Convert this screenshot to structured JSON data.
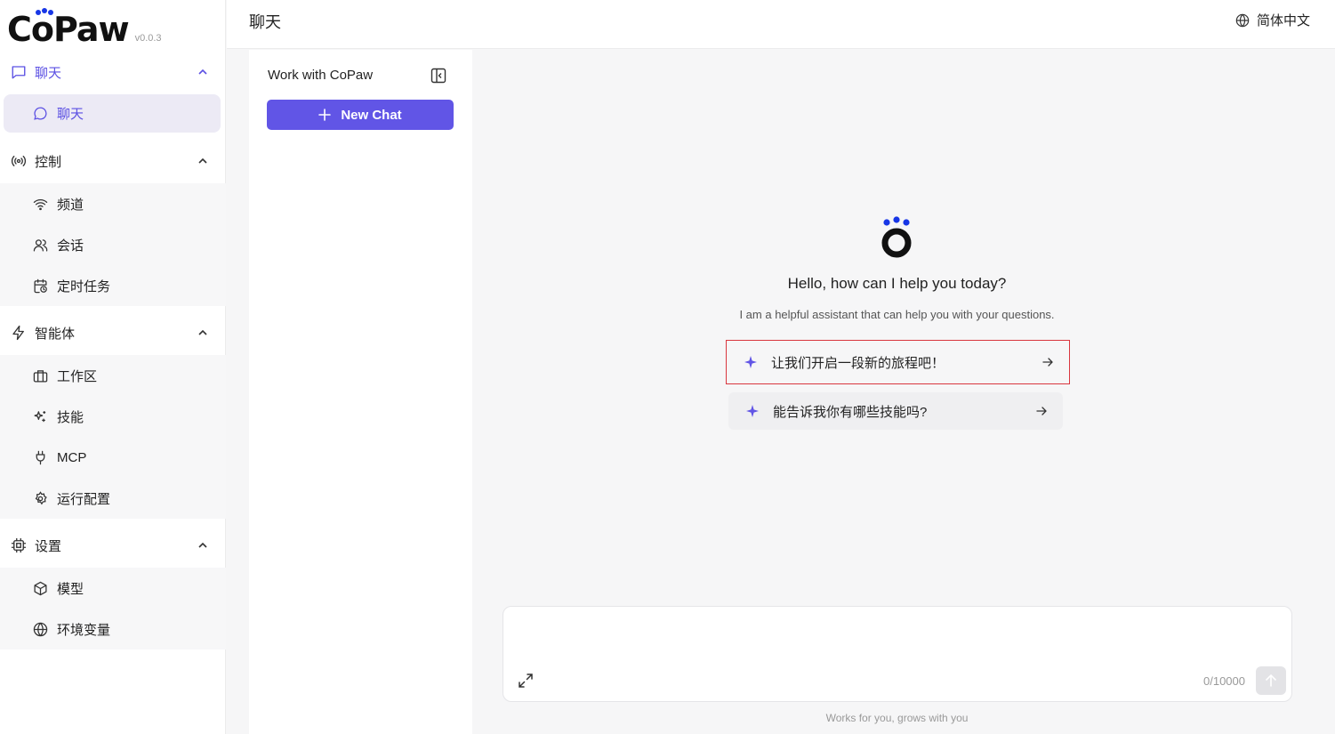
{
  "brand": {
    "name_prefix": "C",
    "name_suffix": "Paw",
    "version": "v0.0.3",
    "dot_color": "#1736e6"
  },
  "sidebar": {
    "groups": [
      {
        "label": "聊天",
        "icon": "message-square-icon",
        "items": [
          {
            "label": "聊天",
            "icon": "message-circle-icon"
          }
        ]
      },
      {
        "label": "控制",
        "icon": "radio-broadcast-icon",
        "items": [
          {
            "label": "频道",
            "icon": "wifi-icon"
          },
          {
            "label": "会话",
            "icon": "users-icon"
          },
          {
            "label": "定时任务",
            "icon": "calendar-clock-icon"
          }
        ]
      },
      {
        "label": "智能体",
        "icon": "zap-icon",
        "items": [
          {
            "label": "工作区",
            "icon": "briefcase-icon"
          },
          {
            "label": "技能",
            "icon": "sparkles-icon"
          },
          {
            "label": "MCP",
            "icon": "plug-icon"
          },
          {
            "label": "运行配置",
            "icon": "gear-icon"
          }
        ]
      },
      {
        "label": "设置",
        "icon": "cpu-icon",
        "items": [
          {
            "label": "模型",
            "icon": "box-icon"
          },
          {
            "label": "环境变量",
            "icon": "globe-icon"
          }
        ]
      }
    ]
  },
  "header": {
    "title": "聊天",
    "language": "简体中文"
  },
  "session_panel": {
    "title": "Work with CoPaw",
    "new_chat_label": "New Chat"
  },
  "main": {
    "welcome_title": "Hello, how can I help you today?",
    "welcome_subtitle": "I am a helpful assistant that can help you with your questions.",
    "suggestions": [
      {
        "text": "让我们开启一段新的旅程吧！"
      },
      {
        "text": "能告诉我你有哪些技能吗?"
      }
    ],
    "input": {
      "value": "",
      "placeholder": "",
      "char_count": "0/10000"
    },
    "footer": "Works for you, grows with you"
  },
  "colors": {
    "accent": "#6155e6",
    "accent_text": "#5b50e3",
    "highlight_border": "#d9363e"
  }
}
